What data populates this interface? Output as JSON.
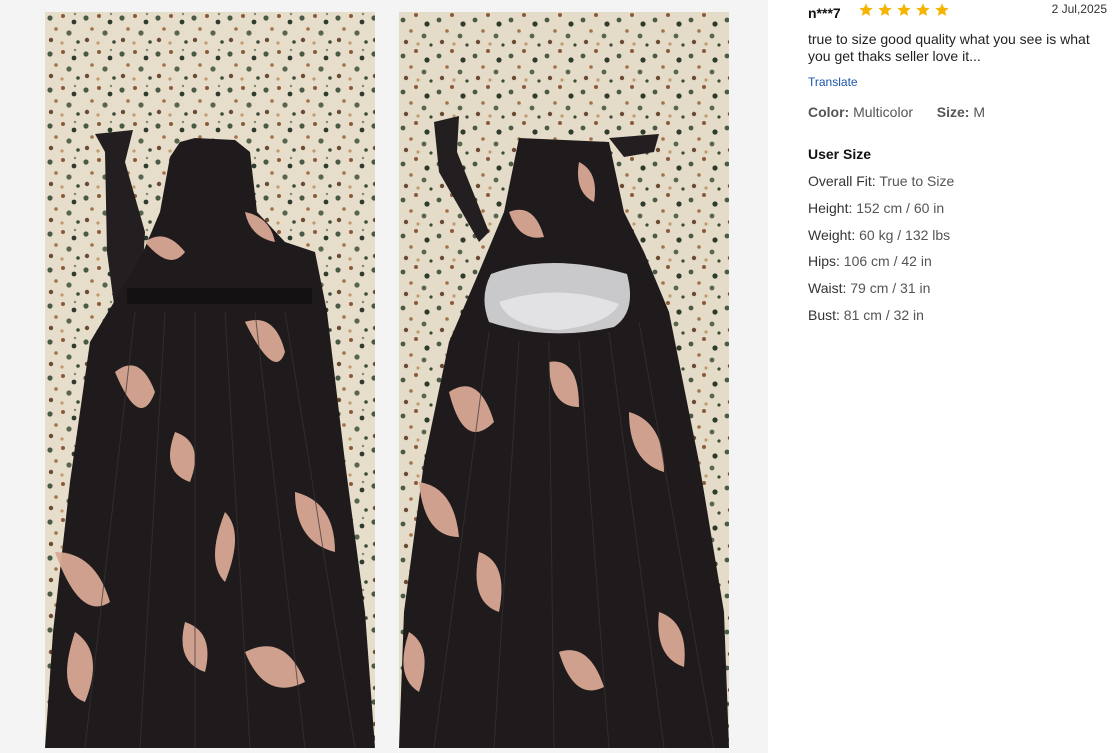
{
  "photos": [
    {
      "name": "dress-front-photo",
      "view": "front"
    },
    {
      "name": "dress-back-photo",
      "view": "back"
    }
  ],
  "review": {
    "username": "n***7",
    "rating": 5,
    "rating_max": 5,
    "date": "2 Jul,2025",
    "comment": "true to size good quality what you see is what you get thaks seller love it...",
    "translate_label": "Translate",
    "color_label": "Color:",
    "color_value": "Multicolor",
    "size_label": "Size:",
    "size_value": "M",
    "star_color": "#f5b400"
  },
  "user_size": {
    "title": "User Size",
    "items": [
      {
        "label": "Overall Fit:",
        "value": "True to Size"
      },
      {
        "label": "Height:",
        "value": "152 cm / 60 in"
      },
      {
        "label": "Weight:",
        "value": "60 kg / 132 lbs"
      },
      {
        "label": "Hips:",
        "value": "106 cm / 42 in"
      },
      {
        "label": "Waist:",
        "value": "79 cm / 31 in"
      },
      {
        "label": "Bust:",
        "value": "81 cm / 32 in"
      }
    ]
  }
}
